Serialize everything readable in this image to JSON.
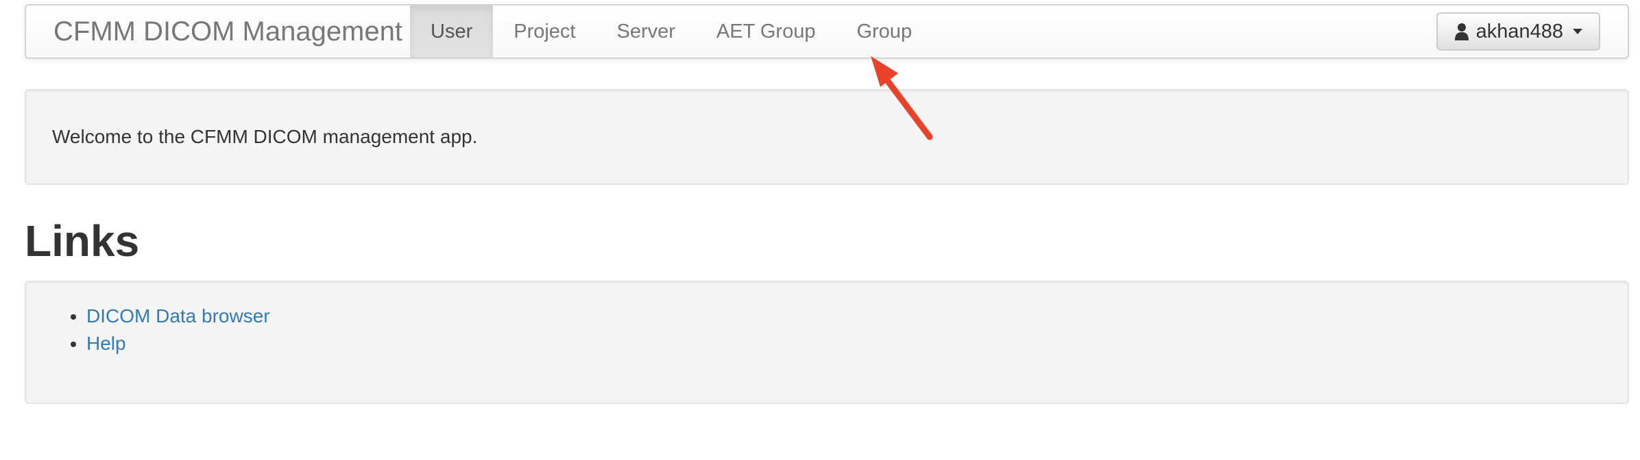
{
  "navbar": {
    "brand": "CFMM DICOM Management",
    "items": [
      {
        "label": "User",
        "active": true
      },
      {
        "label": "Project",
        "active": false
      },
      {
        "label": "Server",
        "active": false
      },
      {
        "label": "AET Group",
        "active": false
      },
      {
        "label": "Group",
        "active": false
      }
    ],
    "user": {
      "icon": "user-icon",
      "name": "akhan488"
    }
  },
  "welcome": {
    "text": "Welcome to the CFMM DICOM management app."
  },
  "links": {
    "heading": "Links",
    "items": [
      {
        "label": "DICOM Data browser"
      },
      {
        "label": "Help"
      }
    ]
  },
  "colors": {
    "link": "#337ab7",
    "annotation_arrow": "#e8432a",
    "well_background": "#f5f5f5"
  }
}
